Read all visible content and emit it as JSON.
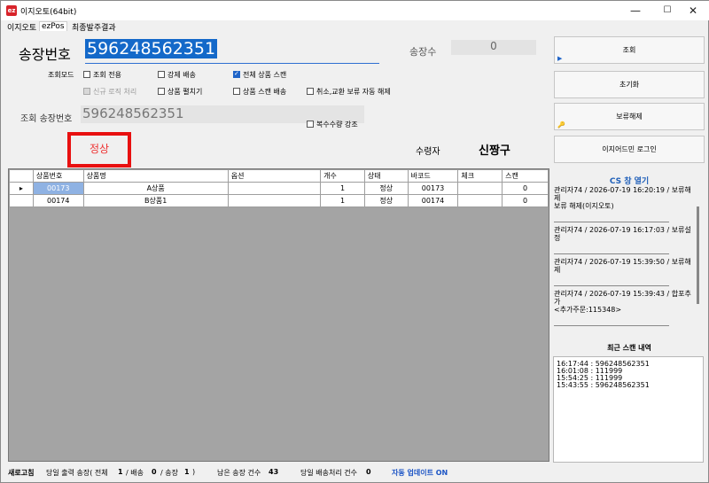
{
  "window": {
    "title": "이지오토(64bit)",
    "icon_text": "ez",
    "min_glyph": "—",
    "max_glyph": "☐",
    "close_glyph": "✕"
  },
  "menus": [
    "이지오토",
    "ezPos",
    "최종발주결과"
  ],
  "form": {
    "invoice_label": "송장번호",
    "invoice_value": "596248562351",
    "count_label": "송장수",
    "count_value": "0",
    "mode_label": "조회모드",
    "lookup_invoice_label": "조회 송장번호",
    "lookup_invoice_value": "596248562351",
    "status_text": "정상",
    "receiver_label": "수령자",
    "receiver_name": "신짱구",
    "checkboxes": {
      "lookup_only": "조회 전용",
      "force_ship": "강제 배송",
      "scan_all": "전체 상품 스캔",
      "new_logic": "신규 로직 처리",
      "expand_items": "상품 펼치기",
      "item_scan_ship": "상품 스캔 배송",
      "cancel_hold": "취소,교환 보류 자동 해제",
      "multi_qty": "복수수량 강조"
    }
  },
  "buttons": {
    "search": "조회",
    "reset": "초기화",
    "release_hold": "보류해제",
    "login": "이지어드민 로그인"
  },
  "table": {
    "headers": [
      "상품번호",
      "상품명",
      "옵션",
      "개수",
      "상태",
      "바코드",
      "체크",
      "스캔"
    ],
    "rows": [
      {
        "code": "00173",
        "name": "A상품",
        "option": "",
        "qty": "1",
        "status": "정상",
        "barcode": "00173",
        "check": "",
        "scan": "0"
      },
      {
        "code": "00174",
        "name": "B상품1",
        "option": "",
        "qty": "1",
        "status": "정상",
        "barcode": "00174",
        "check": "",
        "scan": "0"
      }
    ],
    "row_marker": "▸"
  },
  "cs": {
    "title": "CS 창 열기",
    "logs": [
      {
        "head": "관리자74 / 2026-07-19 16:20:19 / 보류해제",
        "body": "보류 해제(이지오토)"
      },
      {
        "head": "관리자74 / 2026-07-19 16:17:03 / 보류설정",
        "body": ""
      },
      {
        "head": "관리자74 / 2026-07-19 15:39:50 / 보류해제",
        "body": ""
      },
      {
        "head": "관리자74 / 2026-07-19 15:39:43 / 합포추가",
        "body": "<추가주문:115348>"
      }
    ]
  },
  "recent": {
    "title": "최근 스캔 내역",
    "items": [
      "16:17:44 :  596248562351",
      "16:01:08 :  111999",
      "15:54:25 :  111999",
      "15:43:55 :  596248562351"
    ]
  },
  "footer": {
    "refresh": "새로고침",
    "today_label": "당일 출력 송장( 전체",
    "total": "1",
    "ship_label": "/ 배송",
    "ship": "0",
    "inv_label": "/ 송장",
    "inv": "1",
    "close_paren": ")",
    "remain_label": "남은 송장 건수",
    "remain": "43",
    "today_ship_label": "당일 배송처리 건수",
    "today_ship": "0",
    "auto_update": "자동 업데이트 ON"
  }
}
